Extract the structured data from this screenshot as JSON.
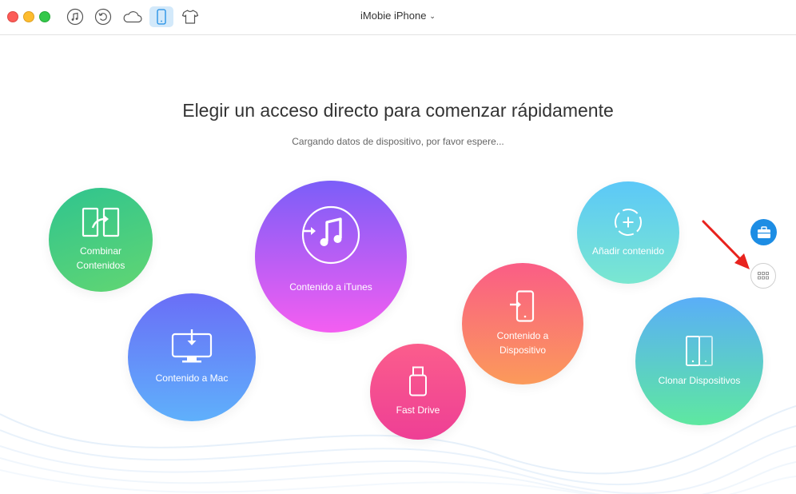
{
  "titlebar": {
    "device_name": "iMobie iPhone",
    "caret": "⌄"
  },
  "toolbar_icons": [
    "music-icon",
    "restore-icon",
    "cloud-icon",
    "phone-icon",
    "tshirt-icon"
  ],
  "main": {
    "headline": "Elegir un acceso directo para comenzar rápidamente",
    "status": "Cargando datos de dispositivo, por favor espere..."
  },
  "shortcuts": {
    "combinar": {
      "line1": "Combinar",
      "line2": "Contenidos",
      "icon": "merge-icon"
    },
    "mac": {
      "label": "Contenido a Mac",
      "icon": "monitor-download-icon"
    },
    "itunes": {
      "label": "Contenido a iTunes",
      "icon": "itunes-icon"
    },
    "fast_drive": {
      "label": "Fast Drive",
      "icon": "usb-drive-icon"
    },
    "dispositivo": {
      "line1": "Contenido a",
      "line2": "Dispositivo",
      "icon": "phone-import-icon"
    },
    "anadir": {
      "label": "Añadir contenido",
      "icon": "add-circle-icon"
    },
    "clonar": {
      "label": "Clonar Dispositivos",
      "icon": "clone-phones-icon"
    }
  },
  "side_buttons": [
    "toolbox-icon",
    "grid-icon"
  ],
  "colors": {
    "accent": "#1d8de4",
    "annotation_arrow": "#e8231e"
  }
}
